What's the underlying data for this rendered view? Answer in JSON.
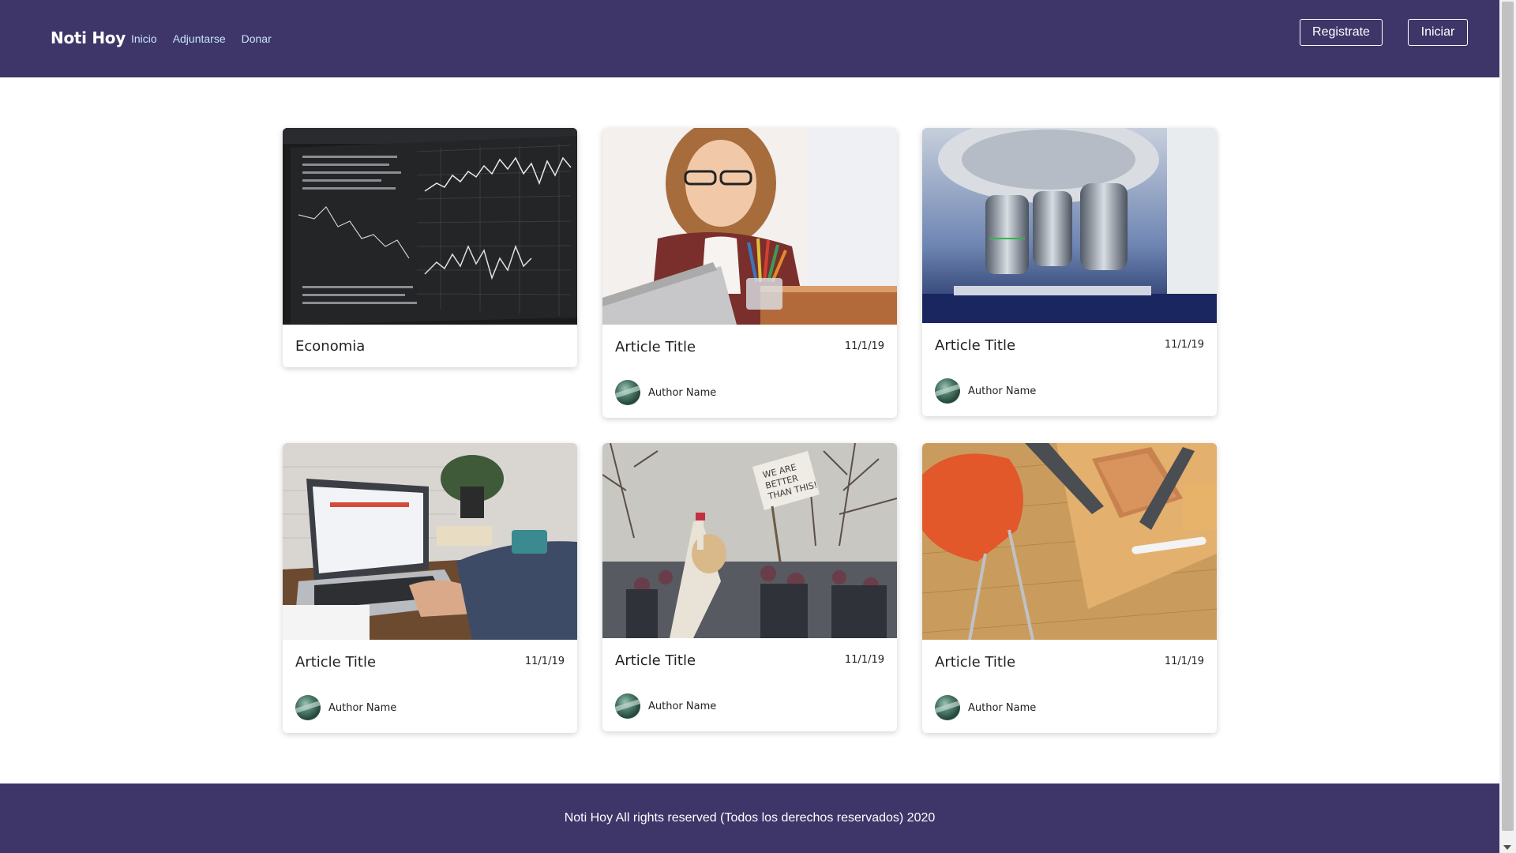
{
  "navbar": {
    "brand": "Noti Hoy",
    "links": [
      "Inicio",
      "Adjuntarse",
      "Donar"
    ],
    "register_label": "Registrate",
    "login_label": "Iniciar"
  },
  "cards": [
    {
      "title": "Economia",
      "image": "stock-chart-monitor-image"
    },
    {
      "title": "Article Title",
      "date": "11/1/19",
      "author": "Author Name",
      "image": "woman-with-laptop-image"
    },
    {
      "title": "Article Title",
      "date": "11/1/19",
      "author": "Author Name",
      "image": "microscope-image"
    },
    {
      "title": "Article Title",
      "date": "11/1/19",
      "author": "Author Name",
      "image": "laptop-desk-image"
    },
    {
      "title": "Article Title",
      "date": "11/1/19",
      "author": "Author Name",
      "image": "protest-march-image"
    },
    {
      "title": "Article Title",
      "date": "11/1/19",
      "author": "Author Name",
      "image": "wooden-desk-chair-image"
    }
  ],
  "footer": {
    "text": "Noti Hoy All rights reserved (Todos los derechos reservados) 2020"
  },
  "colors": {
    "header_bg": "#3e3668",
    "footer_bg": "#3e3668",
    "nav_link": "#c8e4ff"
  }
}
